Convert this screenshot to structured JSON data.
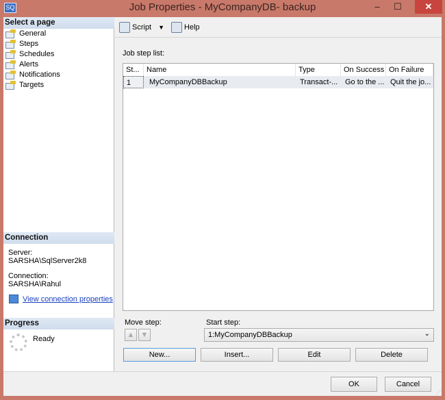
{
  "window": {
    "title": "Job Properties - MyCompanyDB- backup",
    "app_icon": "ssms-icon",
    "minimize": "–",
    "maximize": "☐",
    "close": "✕"
  },
  "sidebar": {
    "header": "Select a page",
    "items": [
      {
        "label": "General"
      },
      {
        "label": "Steps"
      },
      {
        "label": "Schedules"
      },
      {
        "label": "Alerts"
      },
      {
        "label": "Notifications"
      },
      {
        "label": "Targets"
      }
    ]
  },
  "connection": {
    "header": "Connection",
    "server_label": "Server:",
    "server": "SARSHA\\SqlServer2k8",
    "connection_label": "Connection:",
    "connection": "SARSHA\\Rahul",
    "view_link": "View connection properties"
  },
  "progress": {
    "header": "Progress",
    "status": "Ready"
  },
  "toolbar": {
    "script": "Script",
    "help": "Help"
  },
  "steps": {
    "label": "Job step list:",
    "columns": [
      "St...",
      "Name",
      "Type",
      "On Success",
      "On Failure"
    ],
    "rows": [
      [
        "1",
        "MyCompanyDBBackup",
        "Transact-...",
        "Go to the ...",
        "Quit the jo..."
      ]
    ]
  },
  "move_step": {
    "label": "Move step:"
  },
  "start_step": {
    "label": "Start step:",
    "value": "1:MyCompanyDBBackup"
  },
  "buttons": {
    "new": "New...",
    "insert": "Insert...",
    "edit": "Edit",
    "delete": "Delete",
    "ok": "OK",
    "cancel": "Cancel"
  }
}
